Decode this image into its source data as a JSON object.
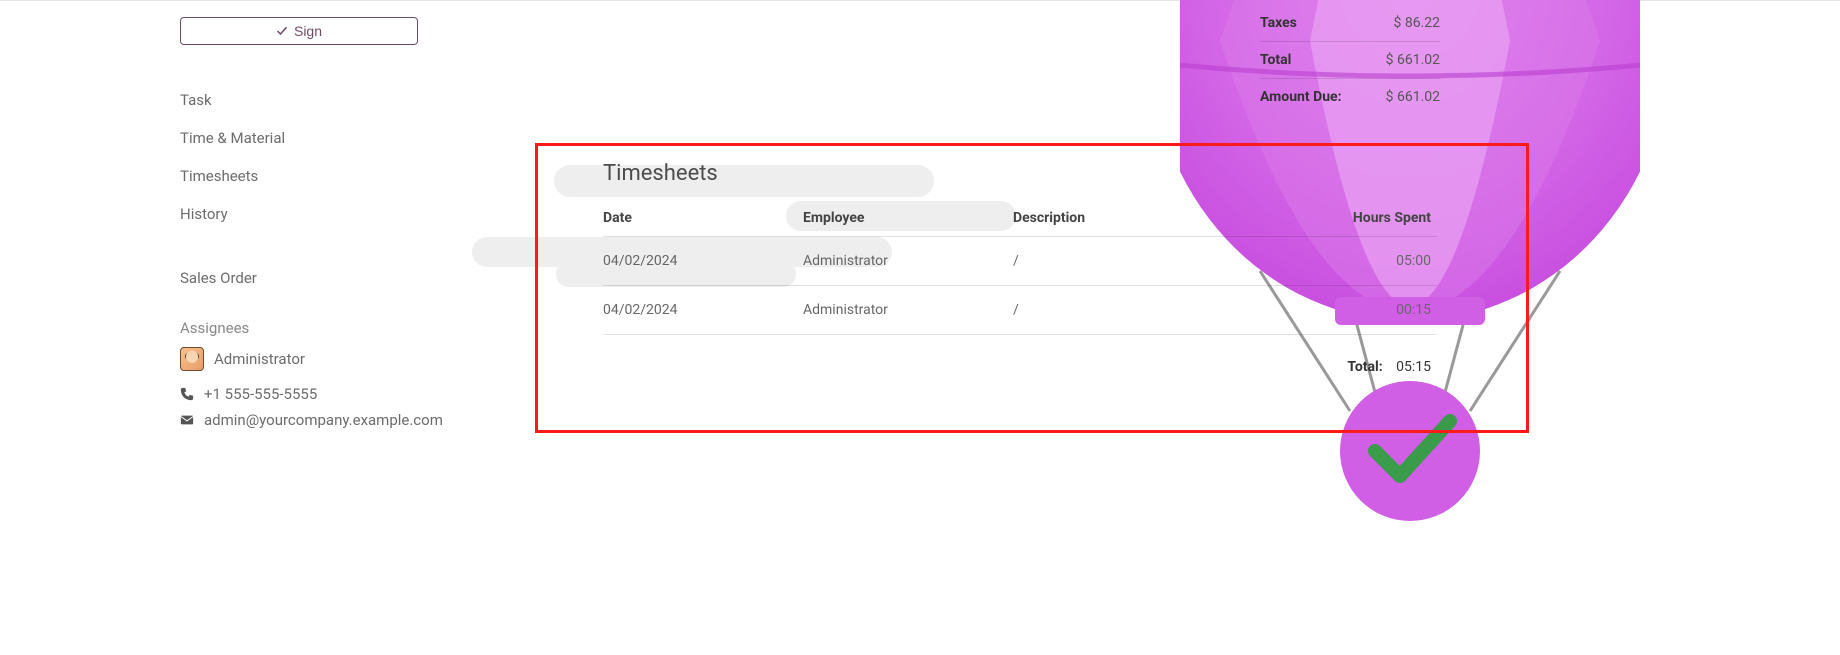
{
  "sign_label": "Sign",
  "sidebar": {
    "items": [
      "Task",
      "Time & Material",
      "Timesheets",
      "History"
    ],
    "sales_order_label": "Sales Order",
    "assignees_label": "Assignees",
    "assignee_name": "Administrator",
    "phone": "+1 555-555-5555",
    "email": "admin@yourcompany.example.com"
  },
  "summary": {
    "taxes_label": "Taxes",
    "taxes_value": "$ 86.22",
    "total_label": "Total",
    "total_value": "$ 661.02",
    "due_label": "Amount Due:",
    "due_value": "$ 661.02"
  },
  "timesheets": {
    "title": "Timesheets",
    "columns": {
      "date": "Date",
      "employee": "Employee",
      "description": "Description",
      "hours": "Hours Spent"
    },
    "rows": [
      {
        "date": "04/02/2024",
        "employee": "Administrator",
        "description": "/",
        "hours": "05:00"
      },
      {
        "date": "04/02/2024",
        "employee": "Administrator",
        "description": "/",
        "hours": "00:15"
      }
    ],
    "total_label": "Total:",
    "total_hours": "05:15"
  }
}
